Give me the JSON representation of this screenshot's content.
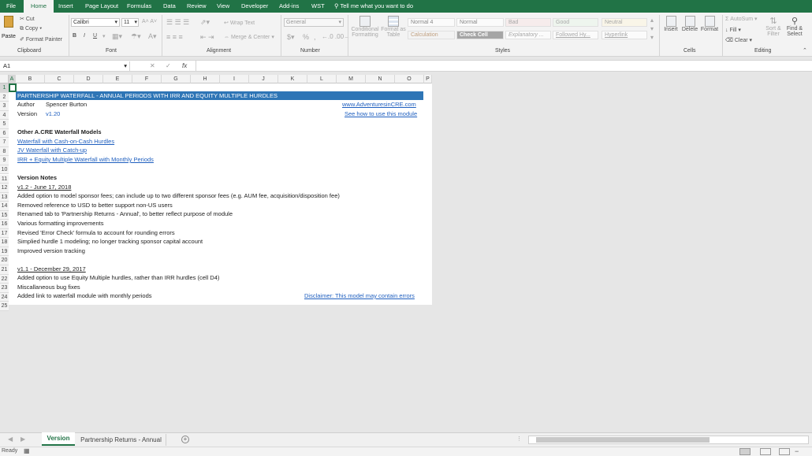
{
  "ribbon_tabs": [
    "File",
    "Home",
    "Insert",
    "Page Layout",
    "Formulas",
    "Data",
    "Review",
    "View",
    "Developer",
    "Add-ins",
    "WST"
  ],
  "tell_me": "Tell me what you want to do",
  "clipboard": {
    "paste": "Paste",
    "cut": "Cut",
    "copy": "Copy",
    "format_painter": "Format Painter",
    "label": "Clipboard"
  },
  "font": {
    "name": "Calibri",
    "size": "11",
    "bold": "B",
    "italic": "I",
    "underline": "U",
    "label": "Font"
  },
  "alignment": {
    "wrap": "Wrap Text",
    "merge": "Merge & Center",
    "label": "Alignment"
  },
  "number": {
    "format": "General",
    "currency": "$",
    "percent": "%",
    "comma": ",",
    "label": "Number"
  },
  "styles_group": {
    "conditional": [
      "Conditional",
      "Formatting"
    ],
    "format_table": [
      "Format as",
      "Table"
    ],
    "label": "Styles",
    "cells": [
      "Normal 4",
      "Normal",
      "Bad",
      "Good",
      "Neutral",
      "Calculation",
      "Check Cell",
      "Explanatory ...",
      "Followed Hy...",
      "Hyperlink"
    ]
  },
  "cells_group": {
    "insert": "Insert",
    "delete": "Delete",
    "format": "Format",
    "label": "Cells"
  },
  "editing": {
    "autosum": "AutoSum",
    "fill": "Fill",
    "clear": "Clear",
    "sort": [
      "Sort &",
      "Filter"
    ],
    "find": [
      "Find &",
      "Select"
    ],
    "label": "Editing"
  },
  "namebox": "A1",
  "fx": "fx",
  "columns": [
    "A",
    "B",
    "C",
    "D",
    "E",
    "F",
    "G",
    "H",
    "I",
    "J",
    "K",
    "L",
    "M",
    "N",
    "O",
    "P"
  ],
  "rows": [
    "1",
    "2",
    "3",
    "4",
    "5",
    "6",
    "7",
    "8",
    "9",
    "10",
    "11",
    "12",
    "13",
    "14",
    "15",
    "16",
    "17",
    "18",
    "19",
    "20",
    "21",
    "22",
    "23",
    "24",
    "25"
  ],
  "sheet": {
    "banner": "PARTNERSHIP WATERFALL - ANNUAL PERIODS WITH IRR AND EQUITY MULTIPLE HURDLES",
    "author_label": "Author",
    "author": "Spencer Burton",
    "version_label": "Version",
    "version": "v1.20",
    "site_link": "www.AdventuresinCRE.com",
    "howto_link": "See how to use this module",
    "other_models_title": "Other A.CRE Waterfall Models",
    "model_links": [
      "Waterfall with Cash-on-Cash Hurdles",
      "JV Waterfall with Catch-up",
      "IRR + Equity Multiple Waterfall with Monthly Periods"
    ],
    "notes_title": "Version Notes",
    "v12_header": "v1.2 - June 17, 2018",
    "v12_notes": [
      "Added option to model sponsor fees; can include up to two different sponsor fees (e.g. AUM fee, acquisition/disposition fee)",
      "Removed reference to USD to better support non-US users",
      "Renamed tab to 'Partnership Returns - Annual', to better reflect purpose of module",
      "Various formatting improvements",
      "Revised 'Error Check' formula to account for rounding errors",
      "Simplied hurdle 1 modeling; no longer tracking sponsor capital account",
      "Improved version tracking"
    ],
    "v11_header": "v1.1 - December 29, 2017",
    "v11_notes": [
      "Added option to use Equity Multiple hurdles, rather than IRR hurdles (cell D4)",
      "Miscallaneous bug fixes",
      "Added link to waterfall module with monthly periods"
    ],
    "disclaimer": "Disclaimer: This model may contain errors"
  },
  "sheet_tabs": [
    "Version",
    "Partnership Returns - Annual"
  ],
  "status": "Ready",
  "colors": {
    "accent": "#217346",
    "banner": "#2e75b6",
    "link": "#1f5fbf"
  }
}
